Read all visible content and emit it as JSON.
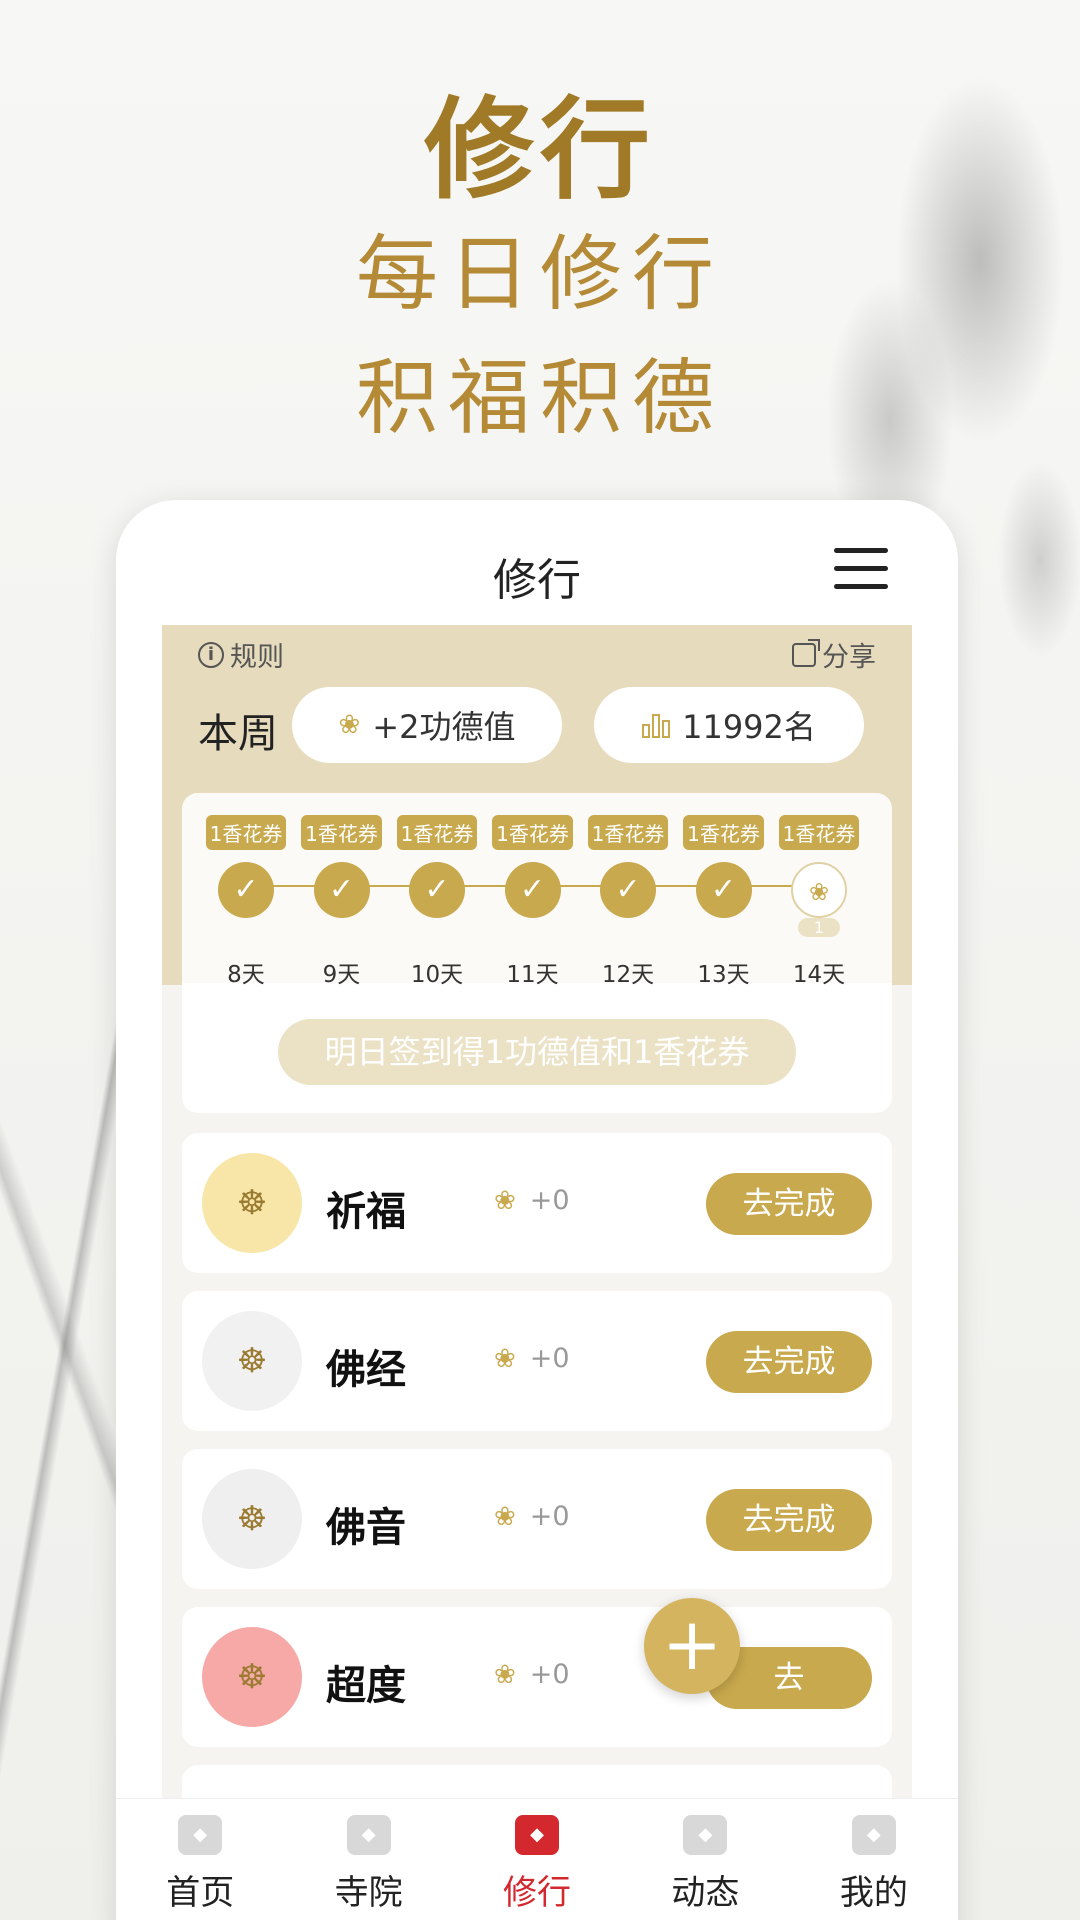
{
  "hero": {
    "title": "修行",
    "line1": "每日修行",
    "line2": "积福积德"
  },
  "header": {
    "title": "修行",
    "menu_icon": "hamburger-menu-icon"
  },
  "summary": {
    "rules_label": "规则",
    "share_label": "分享",
    "week_label": "本周",
    "merit_value": "+2功德值",
    "rank_value": "11992名"
  },
  "checkin": {
    "days": [
      {
        "coupon": "1香花券",
        "label": "8天",
        "done": true
      },
      {
        "coupon": "1香花券",
        "label": "9天",
        "done": true
      },
      {
        "coupon": "1香花券",
        "label": "10天",
        "done": true
      },
      {
        "coupon": "1香花券",
        "label": "11天",
        "done": true
      },
      {
        "coupon": "1香花券",
        "label": "12天",
        "done": true
      },
      {
        "coupon": "1香花券",
        "label": "13天",
        "done": true
      },
      {
        "coupon": "1香花券",
        "label": "14天",
        "done": false,
        "badge": "1"
      }
    ],
    "tomorrow_text": "明日签到得1功德值和1香花券"
  },
  "tasks": [
    {
      "name": "祈福",
      "merit": "+0",
      "button": "去完成",
      "icon": "prayer-icon",
      "icon_bg": "#f8e6a8"
    },
    {
      "name": "佛经",
      "merit": "+0",
      "button": "去完成",
      "icon": "sutra-book-icon",
      "icon_bg": "#f1f1f1"
    },
    {
      "name": "佛音",
      "merit": "+0",
      "button": "去完成",
      "icon": "buddhist-music-icon",
      "icon_bg": "#efefef"
    },
    {
      "name": "超度",
      "merit": "+0",
      "button": "去",
      "icon": "memorial-tablet-icon",
      "icon_bg": "#f6a9a6"
    }
  ],
  "fab": {
    "symbol": "+"
  },
  "tabbar": {
    "items": [
      {
        "label": "首页",
        "icon": "home-gate-icon",
        "active": false
      },
      {
        "label": "寺院",
        "icon": "temple-icon",
        "active": false
      },
      {
        "label": "修行",
        "icon": "practice-icon",
        "active": true
      },
      {
        "label": "动态",
        "icon": "feed-icon",
        "active": false
      },
      {
        "label": "我的",
        "icon": "profile-icon",
        "active": false
      }
    ]
  },
  "colors": {
    "gold": "#c9a94d",
    "band": "#e6dcbd",
    "active_tab": "#d2282e"
  }
}
